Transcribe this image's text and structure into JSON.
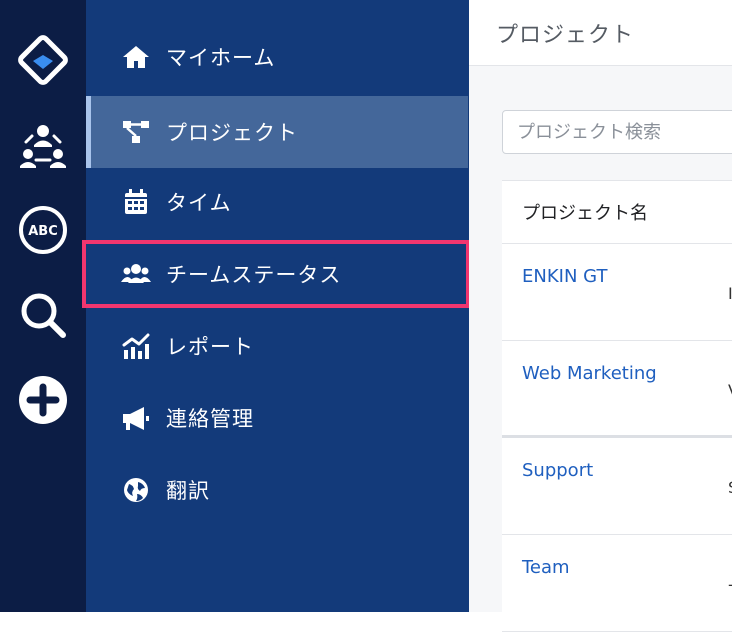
{
  "rail": {
    "icons": [
      "brand-logo-icon",
      "team-network-icon",
      "abc-icon",
      "search-icon",
      "plus-circle-icon"
    ],
    "abc_text": "ABC"
  },
  "sidebar": {
    "items": [
      {
        "label": "マイホーム",
        "icon": "home-icon"
      },
      {
        "label": "プロジェクト",
        "icon": "sitemap-icon",
        "active": true
      },
      {
        "label": "タイム",
        "icon": "calendar-icon"
      },
      {
        "label": "チームステータス",
        "icon": "users-icon",
        "highlighted": true
      },
      {
        "label": "レポート",
        "icon": "chart-icon"
      },
      {
        "label": "連絡管理",
        "icon": "megaphone-icon"
      },
      {
        "label": "翻訳",
        "icon": "globe-icon"
      }
    ]
  },
  "main": {
    "title": "プロジェクト",
    "search_placeholder": "プロジェクト検索",
    "table": {
      "header": "プロジェクト名",
      "rows": [
        {
          "name": "ENKIN GT",
          "second_col": "I"
        },
        {
          "name": "Web Marketing",
          "second_col": "V"
        },
        {
          "name": "Support",
          "second_col": "S"
        },
        {
          "name": "Team",
          "second_col": "-"
        }
      ]
    }
  },
  "colors": {
    "rail_bg": "#0c1d45",
    "sidebar_bg": "#133a7a",
    "active_bg": "#44679a",
    "highlight": "#f2366f",
    "link": "#1f5fbf"
  }
}
